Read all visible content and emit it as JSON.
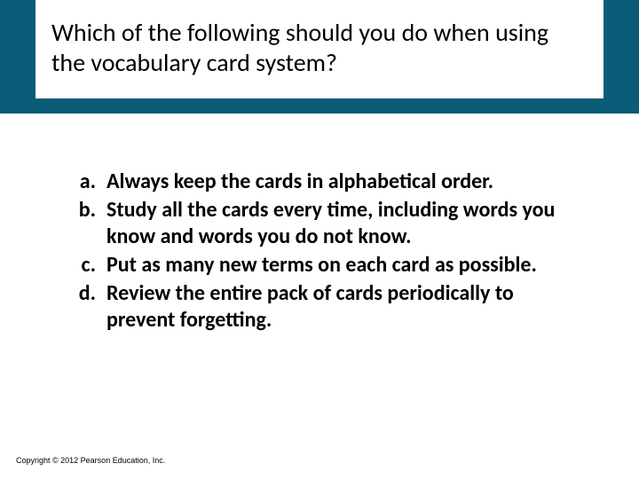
{
  "question": "Which of the following should you do when using the vocabulary card system?",
  "answers": [
    {
      "letter": "a.",
      "text": "Always keep the cards in alphabetical order."
    },
    {
      "letter": "b.",
      "text": "Study all the cards every time, including words you know and words you do not know."
    },
    {
      "letter": "c.",
      "text": "Put as many new terms on each card as possible."
    },
    {
      "letter": "d.",
      "text": "Review the entire pack of cards periodically to prevent forgetting."
    }
  ],
  "copyright": "Copyright © 2012 Pearson Education, Inc."
}
